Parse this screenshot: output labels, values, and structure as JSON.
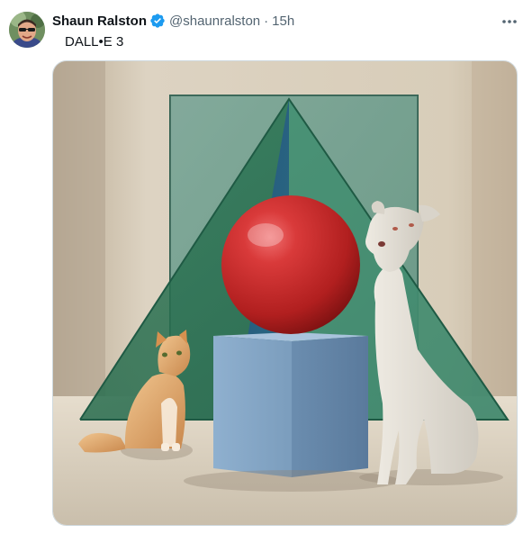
{
  "tweet": {
    "author_name": "Shaun Ralston",
    "author_handle": "@shaunralston",
    "separator": "·",
    "timestamp": "15h",
    "text": "DALL•E 3",
    "verified": true
  },
  "icons": {
    "verified": "verified-badge-icon",
    "more": "more-horizontal-icon"
  },
  "colors": {
    "verified_blue": "#1d9bf0",
    "secondary_text": "#536471",
    "primary_text": "#0f1419"
  },
  "media": {
    "type": "image",
    "description_visible": false
  }
}
